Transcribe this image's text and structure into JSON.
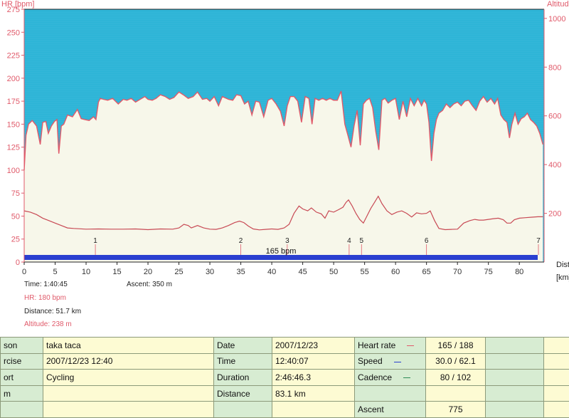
{
  "colors": {
    "plot_bg": "#2cb4d6",
    "hr_fill": "#f7f7ea",
    "hr_line": "#e05a6a",
    "altitude_line": "#c84a55",
    "bar": "#2a3fd0",
    "axis_text": "#e05a6a"
  },
  "chart_data": {
    "type": "area",
    "y_axis_left": {
      "label": "HR [bpm]",
      "range": [
        0,
        275
      ],
      "ticks": [
        0,
        25,
        50,
        75,
        100,
        125,
        150,
        175,
        200,
        225,
        250,
        275
      ]
    },
    "y_axis_right": {
      "label": "Altitude",
      "range": [
        0,
        1037.5
      ],
      "ticks": [
        200,
        400,
        600,
        800,
        1000
      ]
    },
    "x_axis": {
      "label": "Dist\n[km]",
      "range": [
        0,
        84
      ],
      "ticks": [
        0,
        5,
        10,
        15,
        20,
        25,
        30,
        35,
        40,
        45,
        50,
        55,
        60,
        65,
        70,
        75,
        80
      ]
    },
    "bar_label": "165 bpm",
    "markers": [
      {
        "label": "1",
        "x": 11.5
      },
      {
        "label": "2",
        "x": 35
      },
      {
        "label": "3",
        "x": 42.5
      },
      {
        "label": "4",
        "x": 52.5
      },
      {
        "label": "5",
        "x": 54.5
      },
      {
        "label": "6",
        "x": 65
      },
      {
        "label": "7",
        "x": 84
      }
    ],
    "series": [
      {
        "name": "Heart rate",
        "x": [
          0,
          0.3,
          0.7,
          1.3,
          2,
          2.6,
          3,
          3.5,
          3.9,
          4.4,
          4.9,
          5.3,
          5.6,
          6,
          6.4,
          7,
          7.8,
          8.6,
          9.2,
          9.8,
          10.5,
          11.2,
          11.6,
          12,
          12.3,
          12.8,
          13.5,
          14.3,
          15.2,
          16,
          16.6,
          17.3,
          18,
          19,
          19.5,
          20,
          20.7,
          21.3,
          22,
          22.8,
          23.5,
          24.2,
          25,
          25.7,
          26.5,
          27.3,
          28,
          28.8,
          29.5,
          30,
          30.7,
          31.4,
          32,
          33,
          33.7,
          34.3,
          35,
          35.6,
          36.2,
          36.8,
          37.4,
          38,
          38.7,
          39.4,
          40,
          40.7,
          41.4,
          42,
          42.5,
          43,
          43.6,
          44.2,
          44.8,
          45.4,
          46,
          46.5,
          47,
          47.6,
          48.2,
          48.8,
          49.4,
          50,
          50.6,
          51.2,
          51.8,
          52.3,
          52.8,
          53.3,
          53.8,
          54.3,
          54.8,
          55.3,
          55.8,
          56.3,
          56.8,
          57.3,
          57.8,
          58.3,
          58.8,
          59.4,
          60,
          60.6,
          61.2,
          61.8,
          62.4,
          63,
          63.6,
          64.2,
          64.6,
          65,
          65.4,
          65.8,
          66.2,
          66.6,
          67,
          67.6,
          68.2,
          68.8,
          69.4,
          70,
          70.6,
          71.2,
          71.8,
          72.4,
          73,
          73.6,
          74.2,
          74.8,
          75.4,
          76,
          76.5,
          77,
          77.5,
          78,
          78.4,
          78.8,
          79.3,
          79.8,
          80.3,
          80.8,
          81.3,
          81.8,
          82.3,
          82.8,
          83.3,
          83.8
        ],
        "values": [
          100,
          138,
          150,
          154,
          148,
          128,
          152,
          153,
          140,
          148,
          153,
          155,
          118,
          148,
          150,
          160,
          158,
          166,
          156,
          155,
          154,
          158,
          155,
          174,
          178,
          177,
          176,
          178,
          172,
          177,
          176,
          178,
          174,
          178,
          180,
          177,
          176,
          178,
          182,
          180,
          177,
          179,
          185,
          182,
          178,
          180,
          185,
          177,
          178,
          175,
          180,
          170,
          180,
          177,
          176,
          182,
          181,
          172,
          175,
          160,
          175,
          174,
          158,
          176,
          178,
          172,
          164,
          148,
          170,
          180,
          180,
          175,
          152,
          180,
          178,
          150,
          178,
          176,
          178,
          176,
          178,
          176,
          176,
          186,
          150,
          138,
          125,
          148,
          165,
          127,
          172,
          176,
          178,
          168,
          142,
          122,
          176,
          178,
          173,
          176,
          178,
          155,
          175,
          158,
          178,
          170,
          178,
          170,
          176,
          172,
          152,
          110,
          140,
          155,
          162,
          165,
          172,
          168,
          172,
          174,
          170,
          175,
          176,
          170,
          165,
          175,
          180,
          174,
          178,
          172,
          178,
          160,
          155,
          152,
          135,
          150,
          162,
          150,
          156,
          158,
          162,
          155,
          152,
          148,
          140,
          128
        ]
      },
      {
        "name": "Altitude",
        "x": [
          0,
          1,
          2,
          3,
          4,
          5,
          6,
          7,
          8,
          10,
          12,
          14,
          16,
          18,
          20,
          22,
          24,
          25,
          25.8,
          26.5,
          27,
          28,
          29,
          30,
          31,
          32,
          33,
          34,
          34.8,
          35.5,
          36.2,
          37,
          38,
          39,
          40,
          41,
          42,
          42.8,
          43.6,
          44.4,
          45,
          45.8,
          46.4,
          47.2,
          48,
          48.6,
          49.2,
          50,
          50.8,
          51.5,
          52,
          52.4,
          53,
          53.6,
          54.2,
          54.8,
          55.4,
          56,
          56.6,
          57.2,
          57.8,
          58.6,
          59.4,
          60.2,
          61,
          61.8,
          62.6,
          63.4,
          64.2,
          65,
          65.6,
          66.3,
          67,
          68,
          69,
          70,
          71,
          72,
          72.8,
          73.5,
          74.2,
          75,
          75.8,
          76.6,
          77.4,
          78,
          78.6,
          79.2,
          80,
          81,
          82,
          83,
          83.8
        ],
        "values": [
          210,
          205,
          195,
          180,
          170,
          160,
          150,
          140,
          138,
          135,
          136,
          135,
          135,
          136,
          133,
          136,
          135,
          140,
          155,
          150,
          140,
          150,
          140,
          135,
          134,
          140,
          150,
          162,
          168,
          162,
          148,
          136,
          132,
          134,
          136,
          134,
          140,
          155,
          200,
          230,
          218,
          210,
          222,
          205,
          198,
          180,
          210,
          205,
          215,
          225,
          245,
          255,
          230,
          200,
          175,
          160,
          190,
          220,
          245,
          270,
          240,
          210,
          195,
          205,
          210,
          200,
          185,
          202,
          198,
          200,
          210,
          170,
          138,
          133,
          134,
          135,
          160,
          170,
          175,
          172,
          172,
          175,
          178,
          180,
          174,
          160,
          160,
          174,
          180,
          182,
          184,
          186,
          186
        ]
      }
    ]
  },
  "readouts": {
    "time": "Time: 1:40:45",
    "ascent": "Ascent: 350 m",
    "hr": "HR: 180 bpm",
    "distance": "Distance: 51.7 km",
    "altitude": "Altitude: 238 m"
  },
  "table": {
    "rows": [
      {
        "c1": "son",
        "c2": "taka taca",
        "c3": "Date",
        "c4": "2007/12/23",
        "c5": "Heart rate",
        "c6": "165 / 188",
        "legend": "hr"
      },
      {
        "c1": "rcise",
        "c2": "2007/12/23 12:40",
        "c3": "Time",
        "c4": "12:40:07",
        "c5": "Speed",
        "c6": "30.0 / 62.1",
        "legend": "speed"
      },
      {
        "c1": "ort",
        "c2": "Cycling",
        "c3": "Duration",
        "c4": "2:46:46.3",
        "c5": "Cadence",
        "c6": "80 / 102",
        "legend": "cadence"
      },
      {
        "c1": "m",
        "c2": "",
        "c3": "Distance",
        "c4": "83.1 km",
        "c5": "",
        "c6": "",
        "legend": ""
      },
      {
        "c1": "",
        "c2": "",
        "c3": "",
        "c4": "",
        "c5": "Ascent",
        "c6": "775",
        "legend": ""
      }
    ]
  }
}
